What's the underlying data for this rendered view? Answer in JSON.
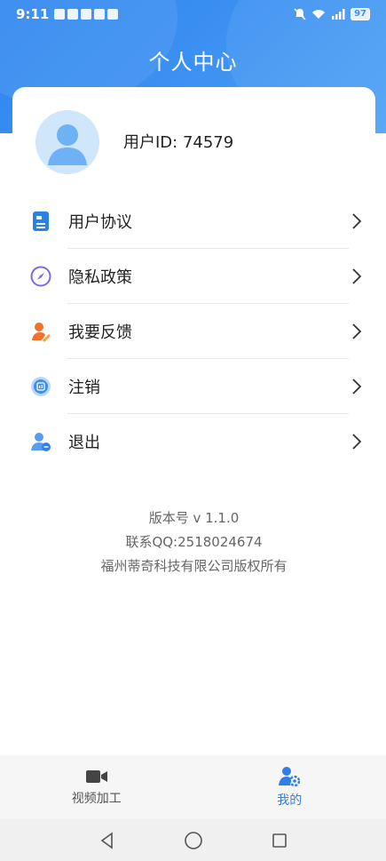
{
  "status_bar": {
    "time": "9:11",
    "battery": "97"
  },
  "header": {
    "title": "个人中心"
  },
  "profile": {
    "user_id_text": "用户ID:  74579"
  },
  "menu": {
    "items": [
      {
        "label": "用户协议",
        "icon": "document-icon",
        "color": "#2a82e4"
      },
      {
        "label": "隐私政策",
        "icon": "compass-icon",
        "color": "#7b68ee"
      },
      {
        "label": "我要反馈",
        "icon": "feedback-icon",
        "color": "#f0722a"
      },
      {
        "label": "注销",
        "icon": "cancel-account-icon",
        "color": "#3d8fe8"
      },
      {
        "label": "退出",
        "icon": "logout-icon",
        "color": "#5a9cf0"
      }
    ]
  },
  "info": {
    "version": "版本号 v 1.1.0",
    "contact": "联系QQ:2518024674",
    "copyright": "福州蒂奇科技有限公司版权所有"
  },
  "tabbar": {
    "tabs": [
      {
        "label": "视频加工",
        "icon": "video-camera-icon",
        "active": false
      },
      {
        "label": "我的",
        "icon": "user-settings-icon",
        "active": true
      }
    ]
  },
  "colors": {
    "accent": "#2f86f0",
    "active_tab": "#2f7fe6"
  }
}
